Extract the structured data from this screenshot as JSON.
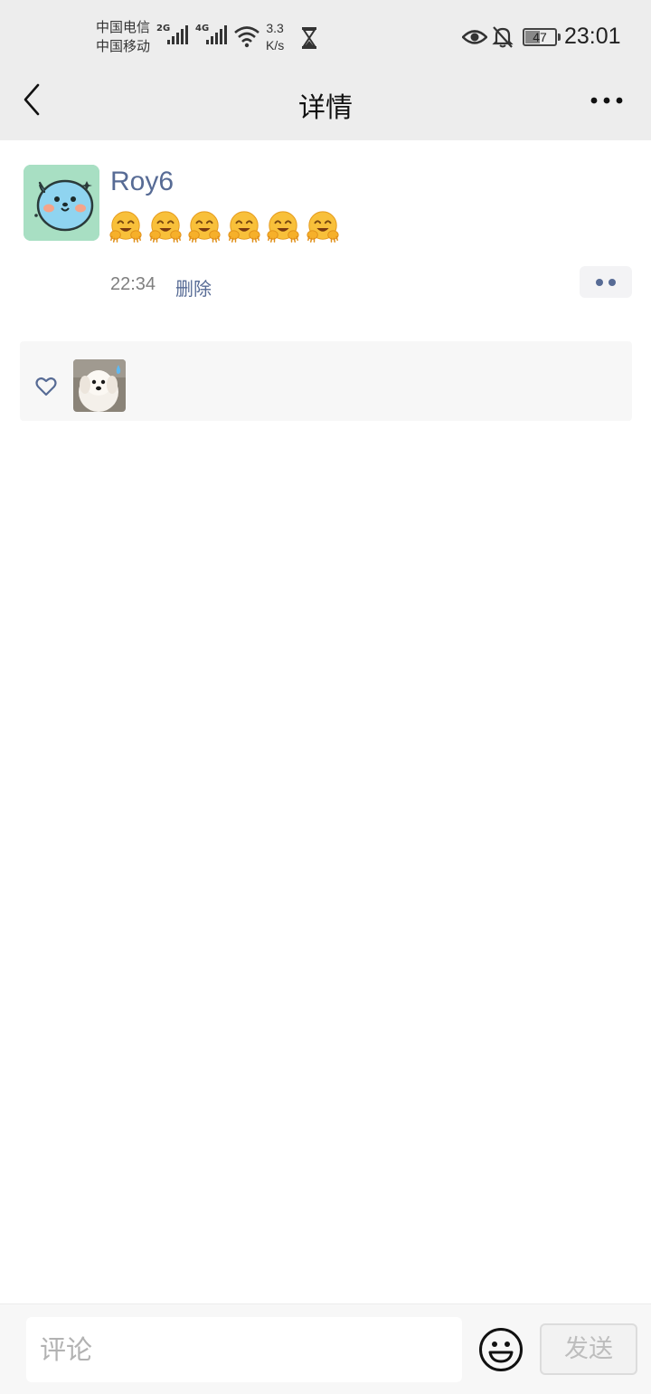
{
  "status_bar": {
    "carrier_1": "中国电信",
    "carrier_2": "中国移动",
    "network_1": "2G",
    "network_2": "4G",
    "speed_value": "3.3",
    "speed_unit": "K/s",
    "battery": "47",
    "battery_level": 0.47,
    "time": "23:01",
    "icons": [
      "signal-icon",
      "wifi-icon",
      "hourglass-icon",
      "eye-icon",
      "bell-off-icon",
      "battery-icon"
    ]
  },
  "header": {
    "title": "详情",
    "back_icon": "chevron-left-icon",
    "more_icon": "more-dots-icon"
  },
  "post": {
    "author": "Roy6",
    "content_emoji": "hugging-face",
    "content_emoji_count": 6,
    "time": "22:34",
    "delete_label": "删除",
    "options_icon": "two-dots-icon"
  },
  "likes": {
    "icon": "heart-outline-icon",
    "count": 1
  },
  "comment_bar": {
    "placeholder": "评论",
    "emoji_icon": "smiley-icon",
    "send_label": "发送"
  },
  "colors": {
    "link": "#576b95",
    "header_bg": "#ededed",
    "avatar_bg": "#a8dfc3",
    "panel_bg": "#f7f7f7"
  }
}
